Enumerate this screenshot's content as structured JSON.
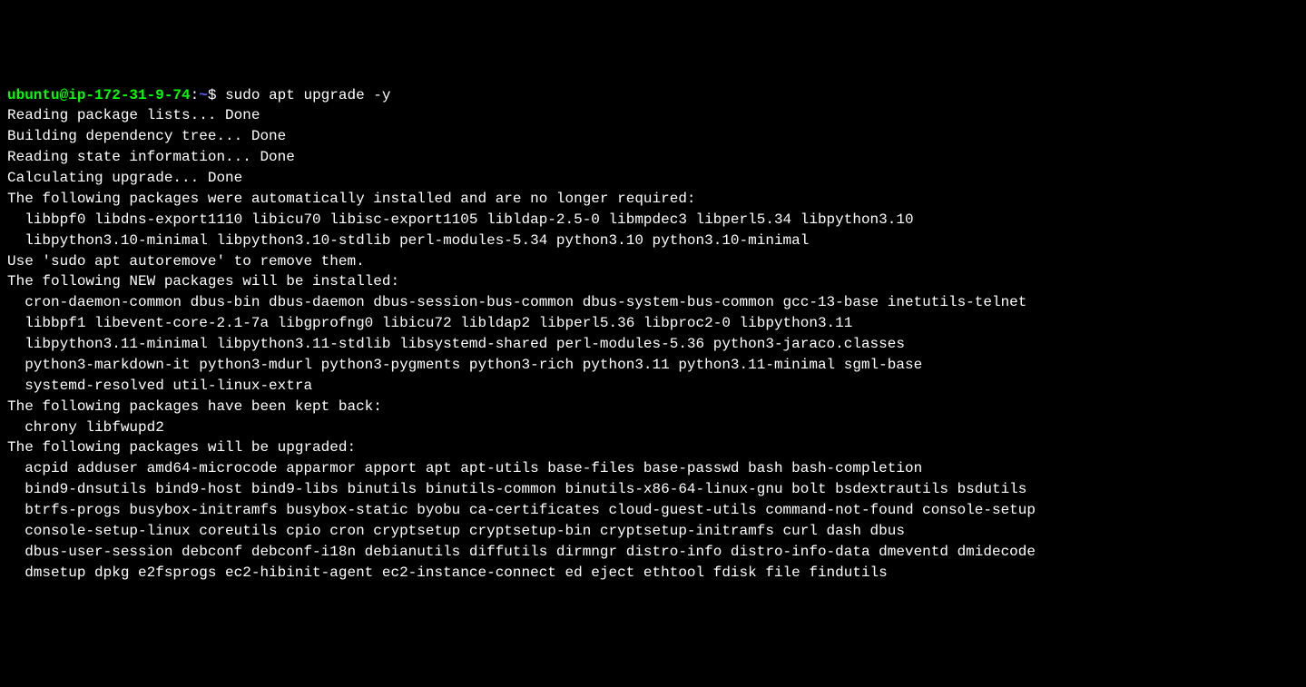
{
  "prompt": {
    "user_host": "ubuntu@ip-172-31-9-74",
    "colon": ":",
    "path": "~",
    "dollar": "$ ",
    "command": "sudo apt upgrade -y",
    "trailing_block": "▌"
  },
  "lines": {
    "l1": "Reading package lists... Done",
    "l2": "Building dependency tree... Done",
    "l3": "Reading state information... Done",
    "l4": "Calculating upgrade... Done",
    "l5": "The following packages were automatically installed and are no longer required:",
    "l6": "  libbpf0 libdns-export1110 libicu70 libisc-export1105 libldap-2.5-0 libmpdec3 libperl5.34 libpython3.10",
    "l7": "  libpython3.10-minimal libpython3.10-stdlib perl-modules-5.34 python3.10 python3.10-minimal",
    "l8": "Use 'sudo apt autoremove' to remove them.",
    "l9": "The following NEW packages will be installed:",
    "l10": "  cron-daemon-common dbus-bin dbus-daemon dbus-session-bus-common dbus-system-bus-common gcc-13-base inetutils-telnet",
    "l11": "  libbpf1 libevent-core-2.1-7a libgprofng0 libicu72 libldap2 libperl5.36 libproc2-0 libpython3.11",
    "l12": "  libpython3.11-minimal libpython3.11-stdlib libsystemd-shared perl-modules-5.36 python3-jaraco.classes",
    "l13": "  python3-markdown-it python3-mdurl python3-pygments python3-rich python3.11 python3.11-minimal sgml-base",
    "l14": "  systemd-resolved util-linux-extra",
    "l15": "The following packages have been kept back:",
    "l16": "  chrony libfwupd2",
    "l17": "The following packages will be upgraded:",
    "l18": "  acpid adduser amd64-microcode apparmor apport apt apt-utils base-files base-passwd bash bash-completion",
    "l19": "  bind9-dnsutils bind9-host bind9-libs binutils binutils-common binutils-x86-64-linux-gnu bolt bsdextrautils bsdutils",
    "l20": "  btrfs-progs busybox-initramfs busybox-static byobu ca-certificates cloud-guest-utils command-not-found console-setup",
    "l21": "  console-setup-linux coreutils cpio cron cryptsetup cryptsetup-bin cryptsetup-initramfs curl dash dbus",
    "l22": "  dbus-user-session debconf debconf-i18n debianutils diffutils dirmngr distro-info distro-info-data dmeventd dmidecode",
    "l23": "  dmsetup dpkg e2fsprogs ec2-hibinit-agent ec2-instance-connect ed eject ethtool fdisk file findutils"
  }
}
